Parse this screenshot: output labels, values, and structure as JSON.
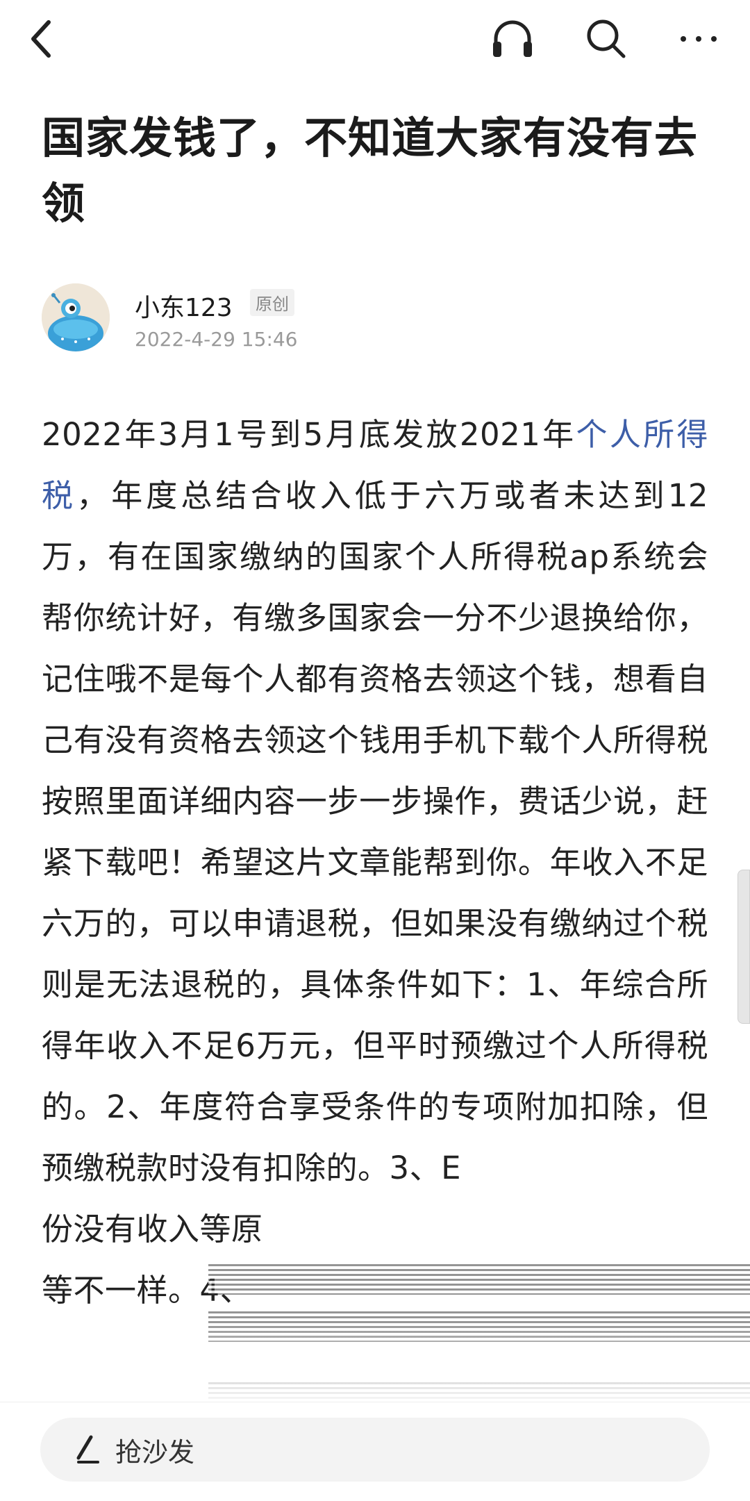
{
  "article": {
    "title": "国家发钱了，不知道大家有没有去领",
    "author": {
      "name": "小东123",
      "badge": "原创",
      "date": "2022-4-29 15:46"
    },
    "content": {
      "part1": "2022年3月1号到5月底发放2021年",
      "link": "个人所得税",
      "part2": "，年度总结合收入低于六万或者未达到12万，有在国家缴纳的国家个人所得税ap系统会帮你统计好，有缴多国家会一分不少退换给你，记住哦不是每个人都有资格去领这个钱，想看自己有没有资格去领这个钱用手机下载个人所得税按照里面详细内容一步一步操作，费话少说，赶紧下载吧！希望这片文章能帮到你。年收入不足六万的，可以申请退税，但如果没有缴纳过个税则是无法退税的，具体条件如下：1、年综合所得年收入不足6万元，但平时预缴过个人所得税的。2、年度符合享受条件的专项附加扣除，但预缴税款时没有扣除的。3、E",
      "part3": "份没有收入等原",
      "part4": "等不一样。4、"
    }
  },
  "bottom_bar": {
    "comment_placeholder": "抢沙发"
  },
  "colors": {
    "link": "#3d5ea8",
    "text": "#222222",
    "muted": "#9a9a9a"
  },
  "icons": [
    "back-arrow-icon",
    "headphone-icon",
    "search-icon",
    "more-icon",
    "pen-icon"
  ]
}
